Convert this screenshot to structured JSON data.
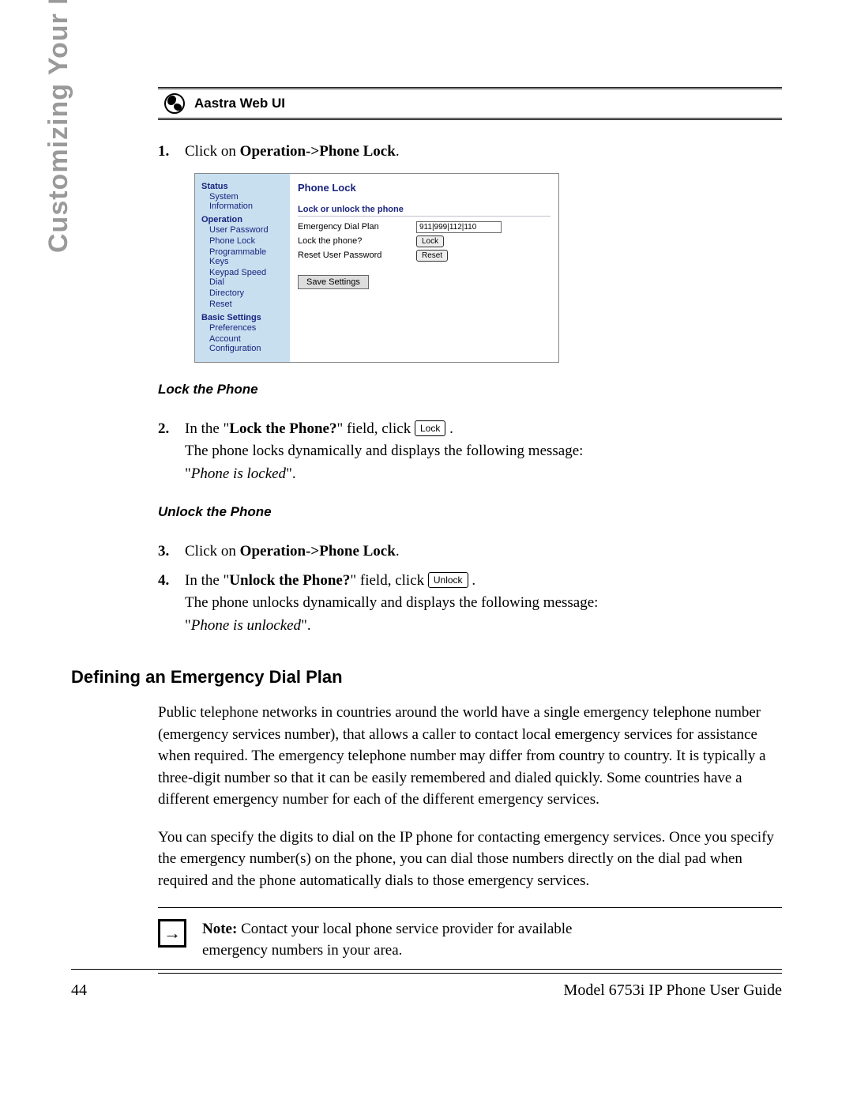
{
  "side_title": "Customizing Your Phone",
  "banner": {
    "label": "Aastra Web UI"
  },
  "step1": {
    "num": "1.",
    "prefix": "Click on ",
    "bold": "Operation->Phone Lock",
    "suffix": "."
  },
  "webui": {
    "sidebar": {
      "status": "Status",
      "status_items": [
        "System Information"
      ],
      "operation": "Operation",
      "operation_items": [
        "User Password",
        "Phone Lock",
        "Programmable Keys",
        "Keypad Speed Dial",
        "Directory",
        "Reset"
      ],
      "basic": "Basic Settings",
      "basic_items": [
        "Preferences",
        "Account Configuration"
      ]
    },
    "main": {
      "title": "Phone Lock",
      "subhead": "Lock or unlock the phone",
      "emergency_label": "Emergency Dial Plan",
      "emergency_value": "911|999|112|110",
      "lock_label": "Lock the phone?",
      "lock_button": "Lock",
      "reset_label": "Reset User Password",
      "reset_button": "Reset",
      "save": "Save Settings"
    }
  },
  "lock_heading": "Lock the Phone",
  "step2": {
    "num": "2.",
    "t1": "In the \"",
    "bold1": "Lock the Phone?",
    "t2": "\" field, click ",
    "btn": "Lock",
    "t3": " .",
    "t4": "The phone locks dynamically and displays the following message:",
    "t5": "\"",
    "ital": "Phone is locked",
    "t6": "\"."
  },
  "unlock_heading": "Unlock the Phone",
  "step3": {
    "num": "3.",
    "prefix": "Click on ",
    "bold": "Operation->Phone Lock",
    "suffix": "."
  },
  "step4": {
    "num": "4.",
    "t1": "In the \"",
    "bold1": "Unlock the Phone?",
    "t2": "\" field, click ",
    "btn": "Unlock",
    "t3": " .",
    "t4": "The phone unlocks dynamically and displays the following message:",
    "t5": "\"",
    "ital": "Phone is unlocked",
    "t6": "\"."
  },
  "section_heading": "Defining an Emergency Dial Plan",
  "para1": "Public telephone networks in countries around the world have a single emergency telephone number (emergency services number), that allows a caller to contact local emergency services for assistance when required. The emergency telephone number may differ from country to country. It is typically a three-digit number so that it can be easily remembered and dialed quickly. Some countries have a different emergency number for each of the different emergency services.",
  "para2": "You can specify the digits to dial on the IP phone for contacting emergency services. Once you specify the emergency number(s) on the phone, you can dial those numbers directly on the dial pad when required and the phone automatically dials to those emergency services.",
  "note": {
    "arrow": "→",
    "bold": "Note:",
    "text": " Contact your local phone service provider for available emergency numbers in your area."
  },
  "footer": {
    "page": "44",
    "model": "Model 6753i IP Phone User Guide"
  }
}
